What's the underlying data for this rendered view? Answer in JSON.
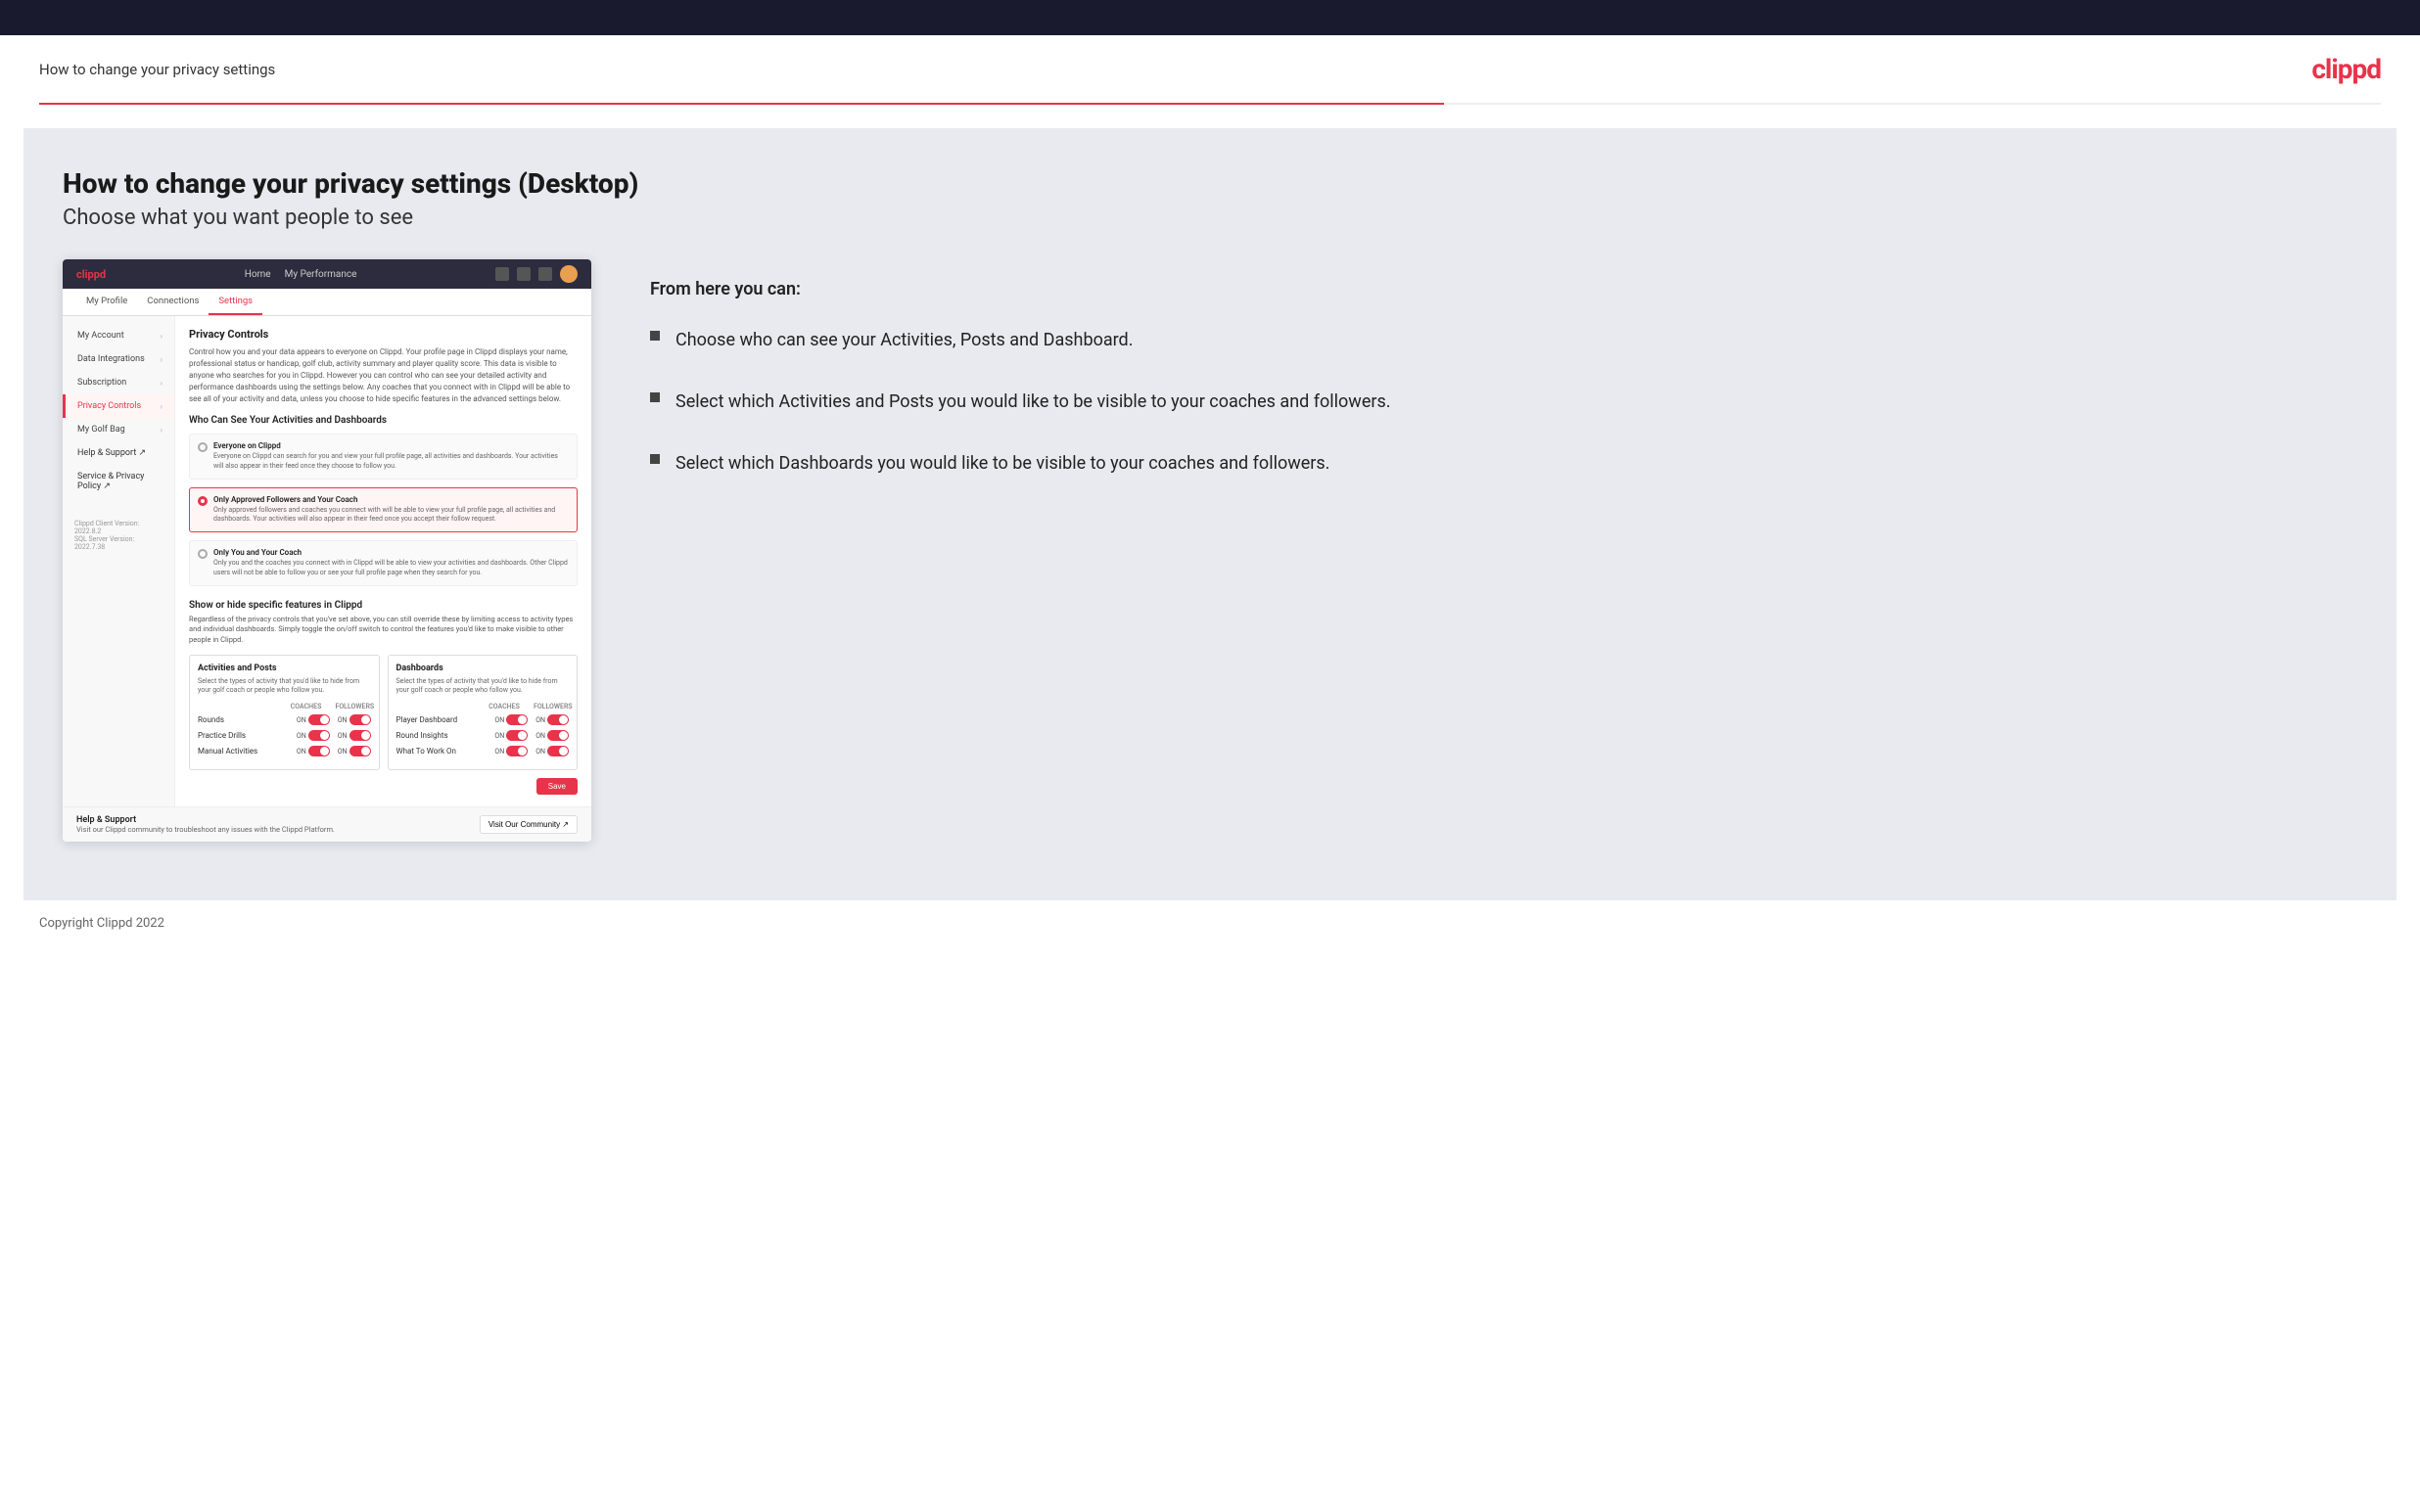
{
  "header": {
    "title": "How to change your privacy settings",
    "logo": "clippd"
  },
  "page": {
    "heading": "How to change your privacy settings (Desktop)",
    "subheading": "Choose what you want people to see"
  },
  "right_panel": {
    "intro": "From here you can:",
    "bullets": [
      "Choose who can see your Activities, Posts and Dashboard.",
      "Select which Activities and Posts you would like to be visible to your coaches and followers.",
      "Select which Dashboards you would like to be visible to your coaches and followers."
    ]
  },
  "mockup": {
    "nav": {
      "logo": "clippd",
      "links": [
        "Home",
        "My Performance"
      ],
      "icons": [
        "search",
        "grid",
        "settings",
        "avatar"
      ]
    },
    "tabs": [
      "My Profile",
      "Connections",
      "Settings"
    ],
    "active_tab": "Settings",
    "sidebar": {
      "items": [
        {
          "label": "My Account",
          "has_arrow": true,
          "active": false
        },
        {
          "label": "Data Integrations",
          "has_arrow": true,
          "active": false
        },
        {
          "label": "Subscription",
          "has_arrow": true,
          "active": false
        },
        {
          "label": "Privacy Controls",
          "has_arrow": true,
          "active": true
        },
        {
          "label": "My Golf Bag",
          "has_arrow": true,
          "active": false
        },
        {
          "label": "Help & Support ↗",
          "has_arrow": false,
          "active": false
        },
        {
          "label": "Service & Privacy Policy ↗",
          "has_arrow": false,
          "active": false
        }
      ],
      "version": "Clippd Client Version: 2022.8.2\nSQL Server Version: 2022.7.38"
    },
    "panel": {
      "title": "Privacy Controls",
      "description": "Control how you and your data appears to everyone on Clippd. Your profile page in Clippd displays your name, professional status or handicap, golf club, activity summary and player quality score. This data is visible to anyone who searches for you in Clippd. However you can control who can see your detailed activity and performance dashboards using the settings below. Any coaches that you connect with in Clippd will be able to see all of your activity and data, unless you choose to hide specific features in the advanced settings below.",
      "visibility_section": {
        "title": "Who Can See Your Activities and Dashboards",
        "options": [
          {
            "label": "Everyone on Clippd",
            "description": "Everyone on Clippd can search for you and view your full profile page, all activities and dashboards. Your activities will also appear in their feed once they choose to follow you.",
            "selected": false
          },
          {
            "label": "Only Approved Followers and Your Coach",
            "description": "Only approved followers and coaches you connect with will be able to view your full profile page, all activities and dashboards. Your activities will also appear in their feed once you accept their follow request.",
            "selected": true
          },
          {
            "label": "Only You and Your Coach",
            "description": "Only you and the coaches you connect with in Clippd will be able to view your activities and dashboards. Other Clippd users will not be able to follow you or see your full profile page when they search for you.",
            "selected": false
          }
        ]
      },
      "features_section": {
        "title": "Show or hide specific features in Clippd",
        "description": "Regardless of the privacy controls that you've set above, you can still override these by limiting access to activity types and individual dashboards. Simply toggle the on/off switch to control the features you'd like to make visible to other people in Clippd.",
        "activities": {
          "title": "Activities and Posts",
          "subtitle": "Select the types of activity that you'd like to hide from your golf coach or people who follow you.",
          "columns": [
            "COACHES",
            "FOLLOWERS"
          ],
          "rows": [
            {
              "label": "Rounds",
              "coaches_on": true,
              "followers_on": true
            },
            {
              "label": "Practice Drills",
              "coaches_on": true,
              "followers_on": true
            },
            {
              "label": "Manual Activities",
              "coaches_on": true,
              "followers_on": true
            }
          ]
        },
        "dashboards": {
          "title": "Dashboards",
          "subtitle": "Select the types of activity that you'd like to hide from your golf coach or people who follow you.",
          "columns": [
            "COACHES",
            "FOLLOWERS"
          ],
          "rows": [
            {
              "label": "Player Dashboard",
              "coaches_on": true,
              "followers_on": true
            },
            {
              "label": "Round Insights",
              "coaches_on": true,
              "followers_on": true
            },
            {
              "label": "What To Work On",
              "coaches_on": true,
              "followers_on": true
            }
          ]
        }
      },
      "save_label": "Save"
    },
    "help_bar": {
      "title": "Help & Support",
      "description": "Visit our Clippd community to troubleshoot any issues with the Clippd Platform.",
      "button_label": "Visit Our Community ↗"
    }
  },
  "footer": {
    "copyright": "Copyright Clippd 2022"
  }
}
